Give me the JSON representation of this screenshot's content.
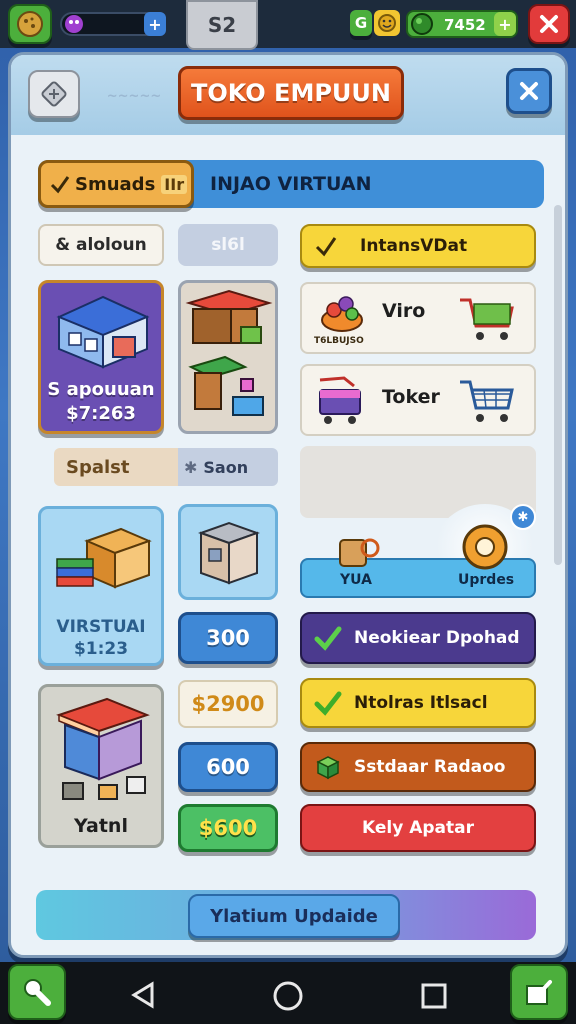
{
  "topbar": {
    "center_tab_label": "S2",
    "right_counter": "7452",
    "currency_badge_letter": "G",
    "colors": {
      "bar": "#1d2b3c",
      "green": "#4caf3c",
      "red": "#e23b3b"
    }
  },
  "header": {
    "title": "TOKO EMPUUN"
  },
  "banner": {
    "left_label": "Smuads",
    "left_tag": "IIr",
    "right_label": "INJAO VIRTUAN"
  },
  "left_panel": {
    "chip_label": "& aloloun",
    "chip_value": "sl6l",
    "shop_card": {
      "line1": "S apouuan",
      "line2": "$7:263"
    },
    "section_label": "Spalst",
    "section_value": "Saon",
    "virtual_card": {
      "line1": "VIRSTUAI",
      "line2": "$1:23"
    },
    "price_buttons": [
      {
        "label": "300",
        "style": "blue"
      },
      {
        "label": "$2900",
        "style": "cream"
      },
      {
        "label": "600",
        "style": "blue"
      },
      {
        "label": "$600",
        "style": "green"
      }
    ],
    "stall_card_label": "Yatnl"
  },
  "right_panel": {
    "yellow_button": "IntansVDat",
    "items": [
      {
        "name": "Viro",
        "sublabel": "T6LBUJSO"
      },
      {
        "name": "Toker",
        "sublabel": ""
      }
    ],
    "upgrade_row": {
      "left": "YUA",
      "right": "Uprdes"
    },
    "action_buttons": [
      {
        "label": "Neokiear Dpohad",
        "color": "#4b3a8e",
        "icon": "check-icon"
      },
      {
        "label": "Ntolras Itlsacl",
        "color": "#f2c531",
        "icon": "check-icon"
      },
      {
        "label": "Sstdaar Radaoo",
        "color": "#c25a1c",
        "icon": "cube-icon"
      },
      {
        "label": "Kely Apatar",
        "color": "#e34040",
        "icon": ""
      }
    ]
  },
  "footer": {
    "update_button": "Ylatium Updaide"
  }
}
